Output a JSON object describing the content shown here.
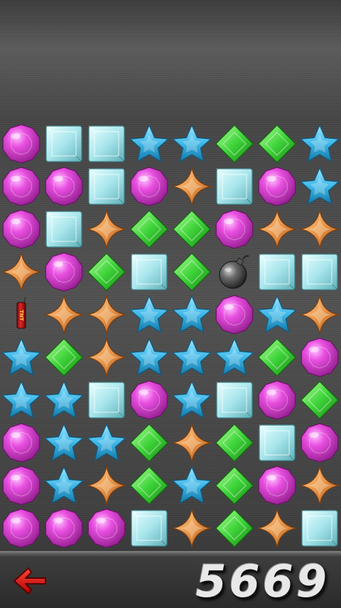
{
  "game": {
    "score": "5669",
    "board_columns": 8,
    "board_rows": 10,
    "board": [
      [
        "pink-gem",
        "cyan-square",
        "cyan-square",
        "blue-star",
        "blue-star",
        "green-diamond",
        "green-diamond",
        "blue-star"
      ],
      [
        "pink-gem",
        "pink-gem",
        "cyan-square",
        "pink-gem",
        "orange-spark",
        "cyan-square",
        "pink-gem",
        "blue-star"
      ],
      [
        "pink-gem",
        "cyan-square",
        "orange-spark",
        "green-diamond",
        "green-diamond",
        "pink-gem",
        "orange-spark",
        "orange-spark"
      ],
      [
        "orange-spark",
        "pink-gem",
        "green-diamond",
        "cyan-square",
        "green-diamond",
        "bomb",
        "cyan-square",
        "cyan-square"
      ],
      [
        "dynamite",
        "orange-spark",
        "orange-spark",
        "blue-star",
        "blue-star",
        "pink-gem",
        "blue-star",
        "orange-spark"
      ],
      [
        "blue-star",
        "green-diamond",
        "orange-spark",
        "blue-star",
        "blue-star",
        "blue-star",
        "green-diamond",
        "pink-gem"
      ],
      [
        "blue-star",
        "blue-star",
        "cyan-square",
        "pink-gem",
        "blue-star",
        "cyan-square",
        "pink-gem",
        "green-diamond"
      ],
      [
        "pink-gem",
        "blue-star",
        "blue-star",
        "green-diamond",
        "orange-spark",
        "green-diamond",
        "cyan-square",
        "pink-gem"
      ],
      [
        "pink-gem",
        "blue-star",
        "orange-spark",
        "green-diamond",
        "blue-star",
        "green-diamond",
        "pink-gem",
        "orange-spark"
      ],
      [
        "pink-gem",
        "pink-gem",
        "pink-gem",
        "cyan-square",
        "orange-spark",
        "green-diamond",
        "orange-spark",
        "cyan-square"
      ]
    ],
    "dynamite_label": "TNT"
  },
  "controls": {
    "back_icon": "back-arrow-icon"
  },
  "colors": {
    "pink": "#e84fe0",
    "cyan": "#a8e6ec",
    "blue": "#3fb8e8",
    "green": "#3fd43a",
    "orange": "#e8954a",
    "bomb": "#6a6a6a",
    "arrow": "#e01010"
  }
}
